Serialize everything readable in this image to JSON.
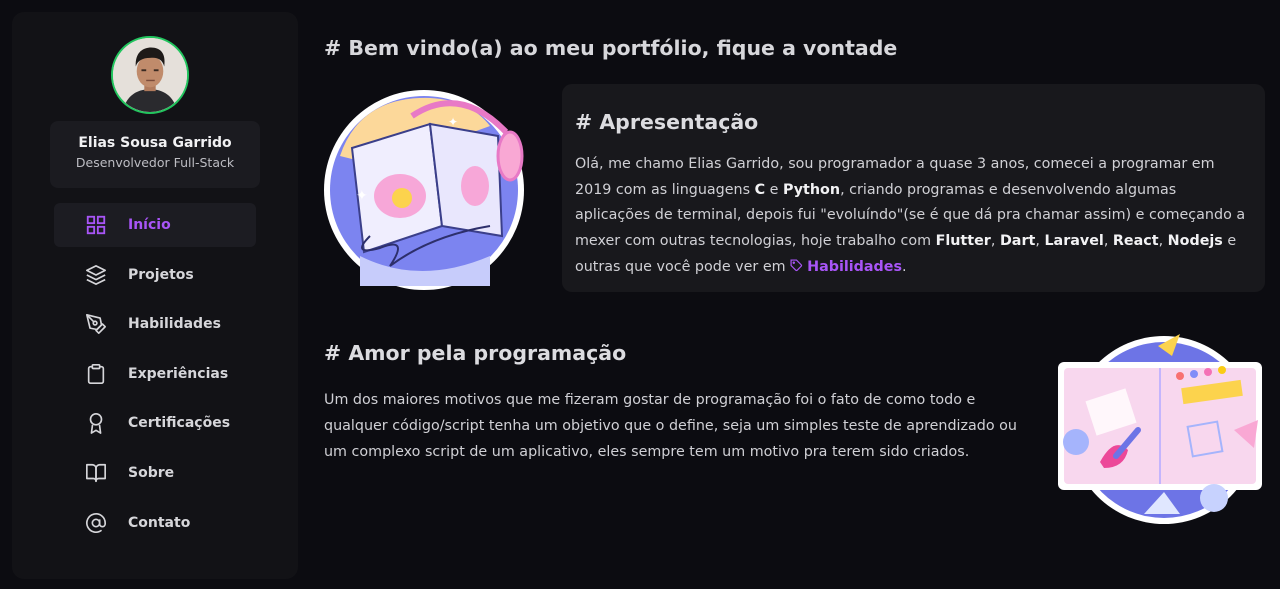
{
  "profile": {
    "name": "Elias Sousa Garrido",
    "role": "Desenvolvedor Full-Stack"
  },
  "nav": [
    {
      "label": "Início",
      "icon": "grid-icon",
      "active": true
    },
    {
      "label": "Projetos",
      "icon": "layers-icon",
      "active": false
    },
    {
      "label": "Habilidades",
      "icon": "pen-tool-icon",
      "active": false
    },
    {
      "label": "Experiências",
      "icon": "clipboard-icon",
      "active": false
    },
    {
      "label": "Certificações",
      "icon": "award-icon",
      "active": false
    },
    {
      "label": "Sobre",
      "icon": "book-open-icon",
      "active": false
    },
    {
      "label": "Contato",
      "icon": "at-sign-icon",
      "active": false
    }
  ],
  "main": {
    "title": "# Bem vindo(a) ao meu portfólio, fique a vontade"
  },
  "presentation": {
    "title": "# Apresentação",
    "p1": "Olá, me chamo Elias Garrido, sou programador a quase 3 anos, comecei a programar em 2019 com as linguagens ",
    "b_c": "C",
    "p2": " e ",
    "b_python": "Python",
    "p3": ", criando programas e desenvolvendo algumas aplicações de terminal, depois fui \"evoluíndo\"(se é que dá pra chamar assim) e começando a mexer com outras tecnologias, hoje trabalho com ",
    "b_flutter": "Flutter",
    "sep1": ", ",
    "b_dart": "Dart",
    "sep2": ", ",
    "b_laravel": "Laravel",
    "sep3": ", ",
    "b_react": "React",
    "sep4": ", ",
    "b_nodejs": "Nodejs",
    "p4": " e outras que você pode ver em ",
    "skills_link": "Habilidades",
    "p5": "."
  },
  "love": {
    "title": "# Amor pela programação",
    "text": "Um dos maiores motivos que me fizeram gostar de programação foi o fato de como todo e qualquer código/script tenha um objetivo que o define, seja um simples teste de aprendizado ou um complexo script de um aplicativo, eles sempre tem um motivo pra terem sido criados."
  },
  "colors": {
    "accent": "#a855f7",
    "avatar_border": "#22c55e",
    "background": "#0c0c11",
    "sidebar": "#121216",
    "card": "#18181c"
  }
}
